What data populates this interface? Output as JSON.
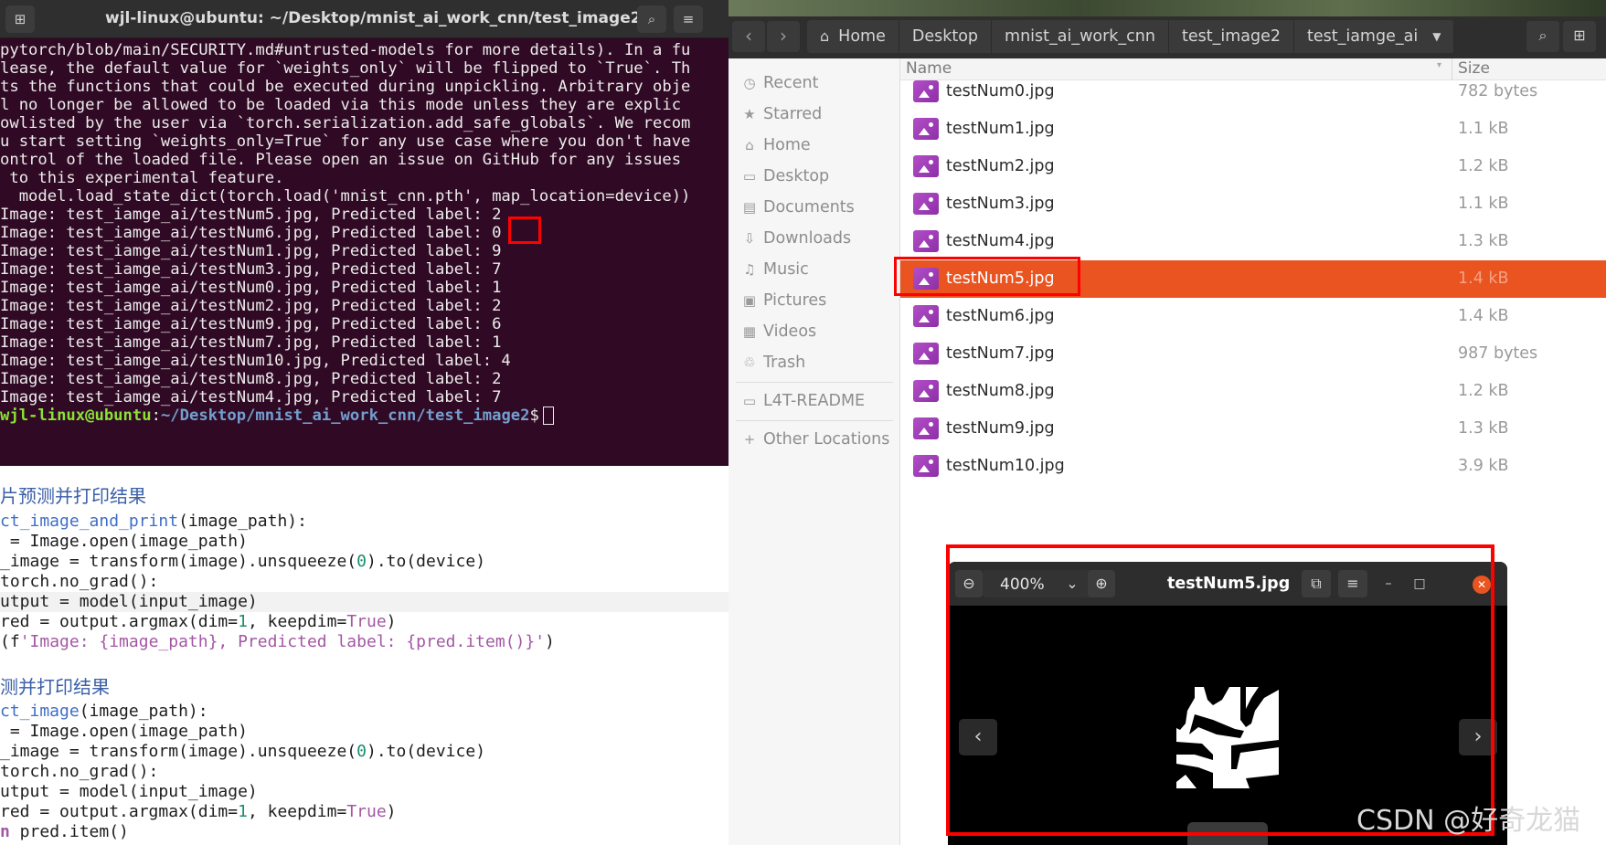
{
  "terminal": {
    "title": "wjl-linux@ubuntu: ~/Desktop/mnist_ai_work_cnn/test_image2",
    "output_lines": [
      "pytorch/blob/main/SECURITY.md#untrusted-models for more details). In a fu",
      "lease, the default value for `weights_only` will be flipped to `True`. Th",
      "ts the functions that could be executed during unpickling. Arbitrary obje",
      "l no longer be allowed to be loaded via this mode unless they are explic",
      "owlisted by the user via `torch.serialization.add_safe_globals`. We recom",
      "u start setting `weights_only=True` for any use case where you don't have",
      "ontrol of the loaded file. Please open an issue on GitHub for any issues",
      " to this experimental feature.",
      "  model.load_state_dict(torch.load('mnist_cnn.pth', map_location=device))",
      "Image: test_iamge_ai/testNum5.jpg, Predicted label: 2",
      "Image: test_iamge_ai/testNum6.jpg, Predicted label: 0",
      "Image: test_iamge_ai/testNum1.jpg, Predicted label: 9",
      "Image: test_iamge_ai/testNum3.jpg, Predicted label: 7",
      "Image: test_iamge_ai/testNum0.jpg, Predicted label: 1",
      "Image: test_iamge_ai/testNum2.jpg, Predicted label: 2",
      "Image: test_iamge_ai/testNum9.jpg, Predicted label: 6",
      "Image: test_iamge_ai/testNum7.jpg, Predicted label: 1",
      "Image: test_iamge_ai/testNum10.jpg, Predicted label: 4",
      "Image: test_iamge_ai/testNum8.jpg, Predicted label: 2",
      "Image: test_iamge_ai/testNum4.jpg, Predicted label: 7"
    ],
    "prompt_user": "wjl-linux@ubuntu",
    "prompt_sep": ":",
    "prompt_path": "~/Desktop/mnist_ai_work_cnn/test_image2",
    "prompt_symbol": "$",
    "new_tab_icon": "new-tab-icon",
    "search_icon": "search-icon",
    "menu_icon": "hamburger-menu-icon"
  },
  "editor": {
    "comment1": "片预测并打印结果",
    "fn1_name": "ct_image_and_print",
    "fn1_args": "(image_path):",
    "b1_l1": " = Image.open(image_path)",
    "b1_l2": "_image = transform(image).unsqueeze(",
    "b1_l2_num": "0",
    "b1_l2_end": ").to(device)",
    "b1_l3": "torch.no_grad():",
    "b1_l4": "utput = model(input_image)",
    "b1_l5a": "red = output.argmax(dim=",
    "b1_l5_num": "1",
    "b1_l5b": ", keepdim=",
    "b1_l5_kw": "True",
    "b1_l5c": ")",
    "b1_l6a": "(f",
    "b1_l6_str": "'Image: {image_path}, Predicted label: {pred.item()}'",
    "b1_l6c": ")",
    "comment2": "测并打印结果",
    "fn2_name": "ct_image",
    "fn2_args": "(image_path):",
    "b2_l1": " = Image.open(image_path)",
    "b2_l2": "_image = transform(image).unsqueeze(",
    "b2_l2_num": "0",
    "b2_l2_end": ").to(device)",
    "b2_l3": "torch.no_grad():",
    "b2_l4": "utput = model(input_image)",
    "b2_l5a": "red = output.argmax(dim=",
    "b2_l5_num": "1",
    "b2_l5b": ", keepdim=",
    "b2_l5_kw": "True",
    "b2_l5c": ")",
    "b2_l6a": "n",
    "b2_l6b": " pred.item()"
  },
  "file_manager": {
    "breadcrumbs": [
      "Home",
      "Desktop",
      "mnist_ai_work_cnn",
      "test_image2",
      "test_iamge_ai"
    ],
    "back_icon": "chevron-left-icon",
    "forward_icon": "chevron-right-icon",
    "sidebar": [
      {
        "label": "Recent",
        "icon": "clock-icon"
      },
      {
        "label": "Starred",
        "icon": "star-icon"
      },
      {
        "label": "Home",
        "icon": "home-icon"
      },
      {
        "label": "Desktop",
        "icon": "desktop-icon"
      },
      {
        "label": "Documents",
        "icon": "document-icon"
      },
      {
        "label": "Downloads",
        "icon": "download-icon"
      },
      {
        "label": "Music",
        "icon": "music-icon"
      },
      {
        "label": "Pictures",
        "icon": "picture-icon"
      },
      {
        "label": "Videos",
        "icon": "video-icon"
      },
      {
        "label": "Trash",
        "icon": "trash-icon"
      },
      {
        "label": "L4T-README",
        "icon": "drive-icon"
      },
      {
        "label": "Other Locations",
        "icon": "plus-icon"
      }
    ],
    "columns": {
      "name": "Name",
      "size": "Size"
    },
    "files": [
      {
        "name": "testNum0.jpg",
        "size": "782 bytes"
      },
      {
        "name": "testNum1.jpg",
        "size": "1.1 kB"
      },
      {
        "name": "testNum2.jpg",
        "size": "1.2 kB"
      },
      {
        "name": "testNum3.jpg",
        "size": "1.1 kB"
      },
      {
        "name": "testNum4.jpg",
        "size": "1.3 kB"
      },
      {
        "name": "testNum5.jpg",
        "size": "1.4 kB"
      },
      {
        "name": "testNum6.jpg",
        "size": "1.4 kB"
      },
      {
        "name": "testNum7.jpg",
        "size": "987 bytes"
      },
      {
        "name": "testNum8.jpg",
        "size": "1.2 kB"
      },
      {
        "name": "testNum9.jpg",
        "size": "1.3 kB"
      },
      {
        "name": "testNum10.jpg",
        "size": "3.9 kB"
      }
    ],
    "selected_file": "testNum5.jpg",
    "selection_color": "#e95420"
  },
  "viewer": {
    "zoom": "400%",
    "title": "testNum5.jpg",
    "zoom_out_icon": "zoom-out-icon",
    "zoom_in_icon": "zoom-in-icon",
    "prev_icon": "chevron-left-icon",
    "next_icon": "chevron-right-icon"
  },
  "colors": {
    "terminal_bg": "#300a24",
    "annotation_red": "#ff0000",
    "accent": "#e95420"
  },
  "watermark": "CSDN @好奇龙猫"
}
